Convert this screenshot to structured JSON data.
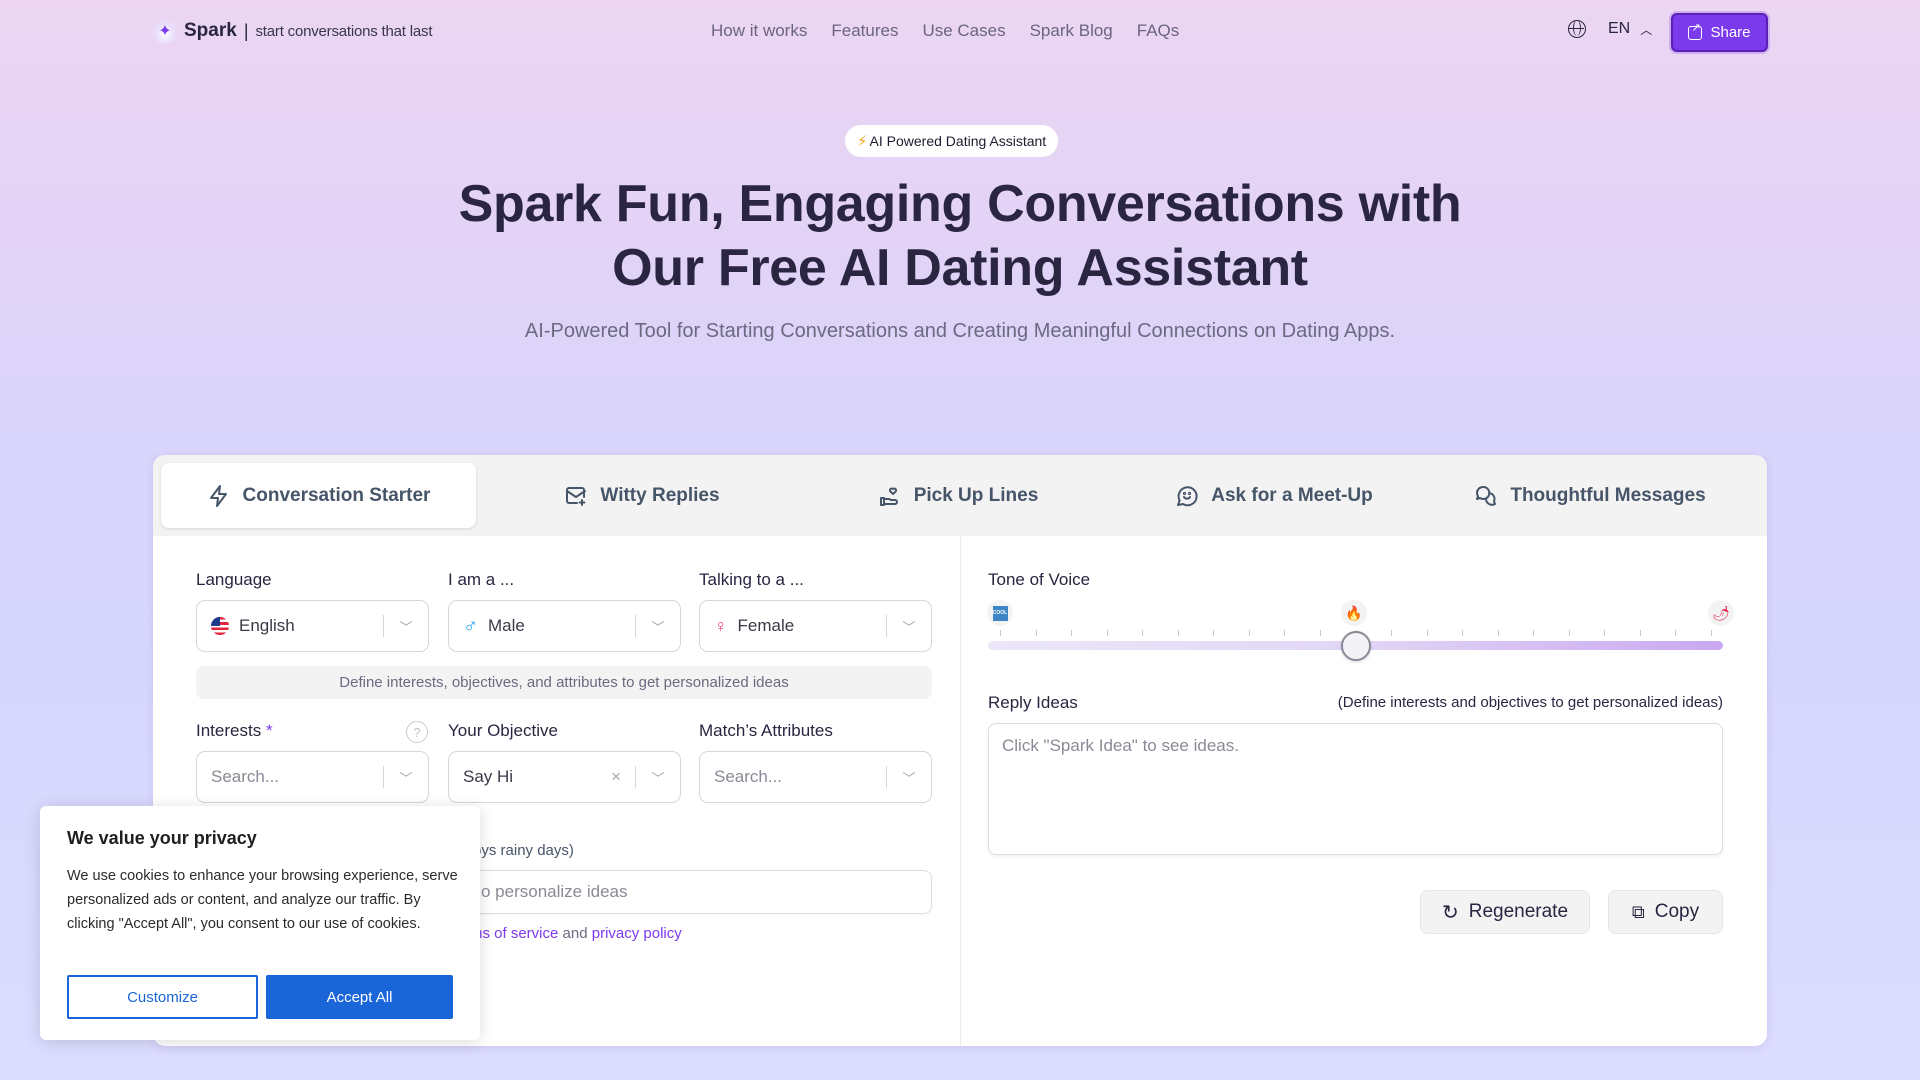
{
  "brand": {
    "name": "Spark",
    "separator": "|",
    "tagline": "start conversations that last"
  },
  "nav": {
    "links": [
      "How it works",
      "Features",
      "Use Cases",
      "Spark Blog",
      "FAQs"
    ]
  },
  "language_switcher": {
    "code": "EN"
  },
  "share_button": {
    "label": "Share"
  },
  "hero": {
    "badge": "AI Powered Dating Assistant",
    "title_line1": "Spark Fun, Engaging Conversations with",
    "title_line2": "Our Free AI Dating Assistant",
    "subtitle": "AI-Powered Tool for Starting Conversations and Creating Meaningful Connections on Dating Apps."
  },
  "tabs": [
    {
      "label": "Conversation Starter",
      "icon": "bolt-icon",
      "active": true
    },
    {
      "label": "Witty Replies",
      "icon": "mail-reply-icon",
      "active": false
    },
    {
      "label": "Pick Up Lines",
      "icon": "hand-heart-icon",
      "active": false
    },
    {
      "label": "Ask for a Meet-Up",
      "icon": "chat-smile-icon",
      "active": false
    },
    {
      "label": "Thoughtful Messages",
      "icon": "messages-icon",
      "active": false
    }
  ],
  "form": {
    "language": {
      "label": "Language",
      "value": "English"
    },
    "iam": {
      "label": "I am a ...",
      "value": "Male"
    },
    "talking_to": {
      "label": "Talking to a ...",
      "value": "Female"
    },
    "hint": "Define interests, objectives, and attributes to get personalized ideas",
    "interests": {
      "label": "Interests",
      "required_mark": "*",
      "placeholder": "Search..."
    },
    "objective": {
      "label": "Your Objective",
      "value": "Say Hi"
    },
    "match_attributes": {
      "label": "Match’s Attributes",
      "placeholder": "Search..."
    },
    "attributes_hint_visible": ", Enjoys rainy days)",
    "attributes_input_placeholder_visible": "o personalize ideas",
    "terms": {
      "prefix_visible": "ms of service",
      "middle": "and",
      "privacy_link": "privacy policy"
    }
  },
  "tone": {
    "label": "Tone of Voice",
    "icons": [
      "cool-icon",
      "fire-icon",
      "chili-icon"
    ],
    "value_fraction": 0.5,
    "tick_count": 21
  },
  "ideas": {
    "label": "Reply Ideas",
    "hint": "(Define interests and objectives to get personalized ideas)",
    "placeholder": "Click \"Spark Idea\" to see ideas.",
    "regenerate_label": "Regenerate",
    "copy_label": "Copy"
  },
  "cookie_banner": {
    "title": "We value your privacy",
    "body": "We use cookies to enhance your browsing experience, serve personalized ads or content, and analyze our traffic. By clicking \"Accept All\", you consent to our use of cookies.",
    "customize_label": "Customize",
    "accept_label": "Accept All"
  },
  "colors": {
    "accent": "#7c3aed",
    "cookie_blue": "#1a66d9"
  }
}
